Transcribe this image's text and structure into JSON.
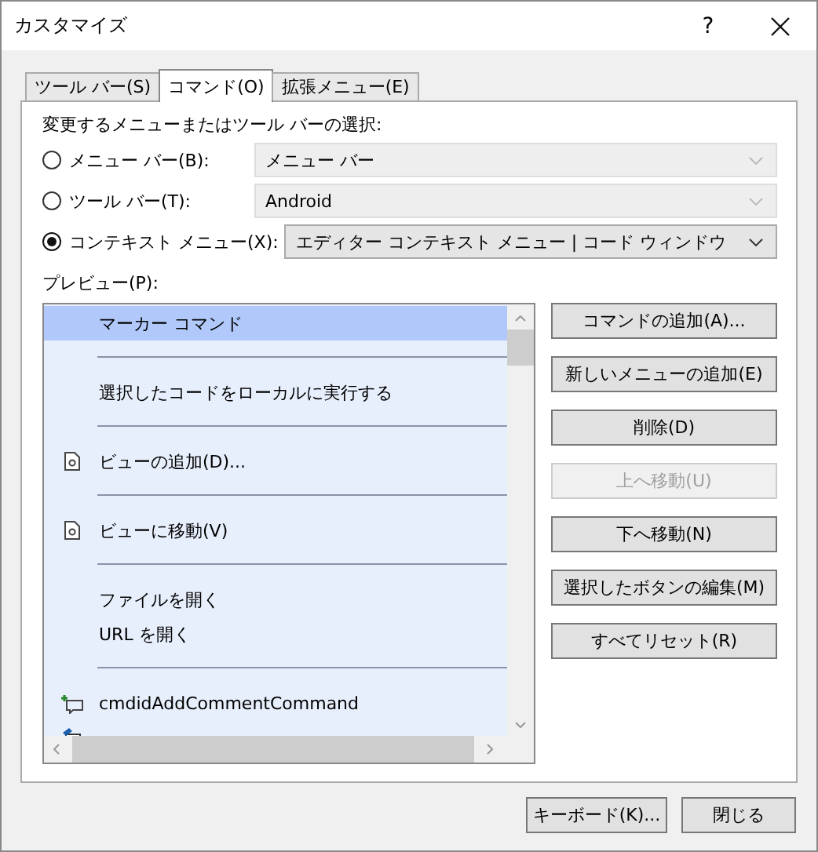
{
  "window": {
    "title": "カスタマイズ",
    "help": "?"
  },
  "tabs": [
    {
      "label": "ツール バー(S)",
      "selected": false
    },
    {
      "label": "コマンド(O)",
      "selected": true
    },
    {
      "label": "拡張メニュー(E)",
      "selected": false
    }
  ],
  "choose_label": "変更するメニューまたはツール バーの選択:",
  "targets": [
    {
      "label": "メニュー バー(B):",
      "selected": false,
      "value": "メニュー バー",
      "disabled": true
    },
    {
      "label": "ツール バー(T):",
      "selected": false,
      "value": "Android",
      "disabled": true
    },
    {
      "label": "コンテキスト メニュー(X):",
      "selected": true,
      "value": "エディター コンテキスト メニュー | コード ウィンドウ",
      "disabled": false
    }
  ],
  "preview": {
    "label": "プレビュー(P):",
    "items": [
      {
        "kind": "command",
        "label": "マーカー コマンド",
        "selected": true
      },
      {
        "kind": "separator"
      },
      {
        "kind": "command",
        "label": "選択したコードをローカルに実行する",
        "selected": false
      },
      {
        "kind": "separator"
      },
      {
        "kind": "document",
        "label": "ビューの追加(D)...",
        "selected": false
      },
      {
        "kind": "separator"
      },
      {
        "kind": "document",
        "label": "ビューに移動(V)",
        "selected": false
      },
      {
        "kind": "separator"
      },
      {
        "kind": "command",
        "label": "ファイルを開く",
        "selected": false
      },
      {
        "kind": "command",
        "label": "URL を開く",
        "selected": false
      },
      {
        "kind": "separator"
      },
      {
        "kind": "comment",
        "label": "cmdidAddCommentCommand",
        "selected": false
      },
      {
        "kind": "edit",
        "selected": false
      }
    ]
  },
  "actions": [
    {
      "label": "コマンドの追加(A)...",
      "disabled": false
    },
    {
      "label": "新しいメニューの追加(E)",
      "disabled": false
    },
    {
      "label": "削除(D)",
      "disabled": false
    },
    {
      "label": "上へ移動(U)",
      "disabled": true
    },
    {
      "label": "下へ移動(N)",
      "disabled": false
    },
    {
      "label": "選択したボタンの編集(M)",
      "disabled": false
    },
    {
      "label": "すべてリセット(R)",
      "disabled": false
    }
  ],
  "footer_buttons": [
    "キーボード(K)...",
    "閉じる"
  ]
}
